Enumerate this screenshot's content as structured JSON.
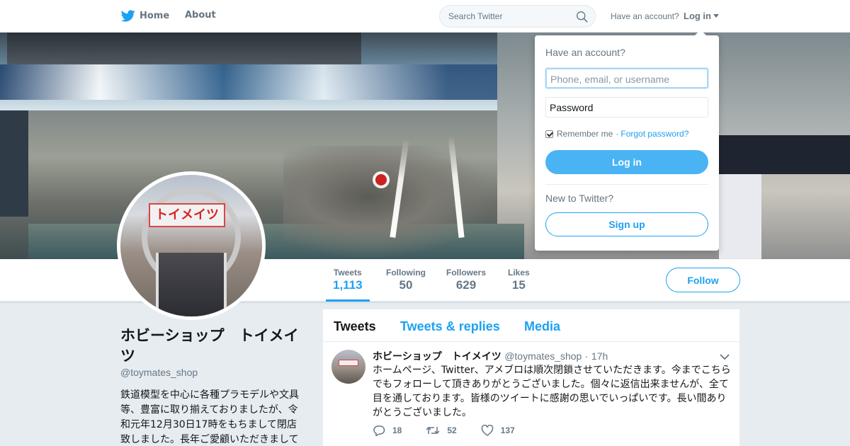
{
  "nav": {
    "home_label": "Home",
    "about_label": "About",
    "search_placeholder": "Search Twitter",
    "have_account": "Have an account?",
    "login_label": "Log in"
  },
  "profile": {
    "name": "ホビーショップ　トイメイツ",
    "handle": "@toymates_shop",
    "bio": "鉄道模型を中心に各種プラモデルや文具等、豊富に取り揃えておりましたが、令和元年12月30日17時をもちまして閉店致しました。長年ご愛顧いただきましてあ",
    "avatar_sign": "トイメイツ"
  },
  "stats": [
    {
      "label": "Tweets",
      "value": "1,113"
    },
    {
      "label": "Following",
      "value": "50"
    },
    {
      "label": "Followers",
      "value": "629"
    },
    {
      "label": "Likes",
      "value": "15"
    }
  ],
  "follow_label": "Follow",
  "timeline": {
    "tabs": [
      "Tweets",
      "Tweets & replies",
      "Media"
    ],
    "tweet": {
      "name": "ホビーショップ　トイメイツ",
      "handle": "@toymates_shop",
      "dot": "·",
      "time": "17h",
      "text": "ホームページ、Twitter、アメブロは順次閉鎖させていただきます。今までこちらでもフォローして頂きありがとうございました。個々に返信出来ませんが、全て目を通しております。皆様のツイートに感謝の思いでいっぱいです。長い間ありがとうございました。",
      "replies": "18",
      "retweets": "52",
      "likes": "137"
    }
  },
  "login_dropdown": {
    "title": "Have an account?",
    "username_placeholder": "Phone, email, or username",
    "password_placeholder": "Password",
    "remember": "Remember me",
    "separator": "·",
    "forgot": "Forgot password?",
    "login_button": "Log in",
    "new_to": "New to Twitter?",
    "signup_button": "Sign up"
  },
  "colors": {
    "accent": "#1da1f2",
    "login_button": "#4ab3f4",
    "page_background": "#e6ecf0"
  }
}
